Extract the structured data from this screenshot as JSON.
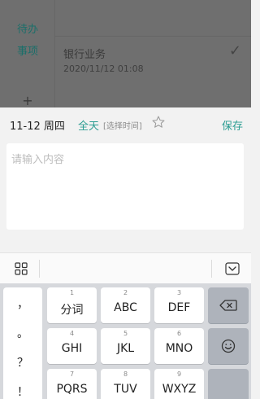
{
  "background_app": {
    "sidebar": {
      "item_line1": "待办",
      "item_line2": "事项",
      "add": "+"
    },
    "task": {
      "title": "银行业务",
      "time": "2020/11/12 01:08",
      "check": "✓"
    }
  },
  "editor": {
    "date": "11-12 周四",
    "all_day": "全天",
    "select_time": "[选择时间]",
    "save": "保存",
    "content_placeholder": "请输入内容"
  },
  "keyboard": {
    "punctuation": [
      "，",
      "。",
      "？",
      "！"
    ],
    "keys": [
      {
        "num": "1",
        "label": "分词"
      },
      {
        "num": "2",
        "label": "ABC"
      },
      {
        "num": "3",
        "label": "DEF"
      },
      {
        "num": "4",
        "label": "GHI"
      },
      {
        "num": "5",
        "label": "JKL"
      },
      {
        "num": "6",
        "label": "MNO"
      },
      {
        "num": "7",
        "label": "PQRS"
      },
      {
        "num": "8",
        "label": "TUV"
      },
      {
        "num": "9",
        "label": "WXYZ"
      }
    ],
    "icons": {
      "toolbar_left": "grid-icon",
      "toolbar_right": "hide-keyboard-icon",
      "delete": "backspace-icon",
      "emoji": "emoji-icon"
    }
  },
  "colors": {
    "accent": "#2b9d92",
    "overlay": "#6f6f6f",
    "keyboard_bg": "#d6d8dc"
  }
}
